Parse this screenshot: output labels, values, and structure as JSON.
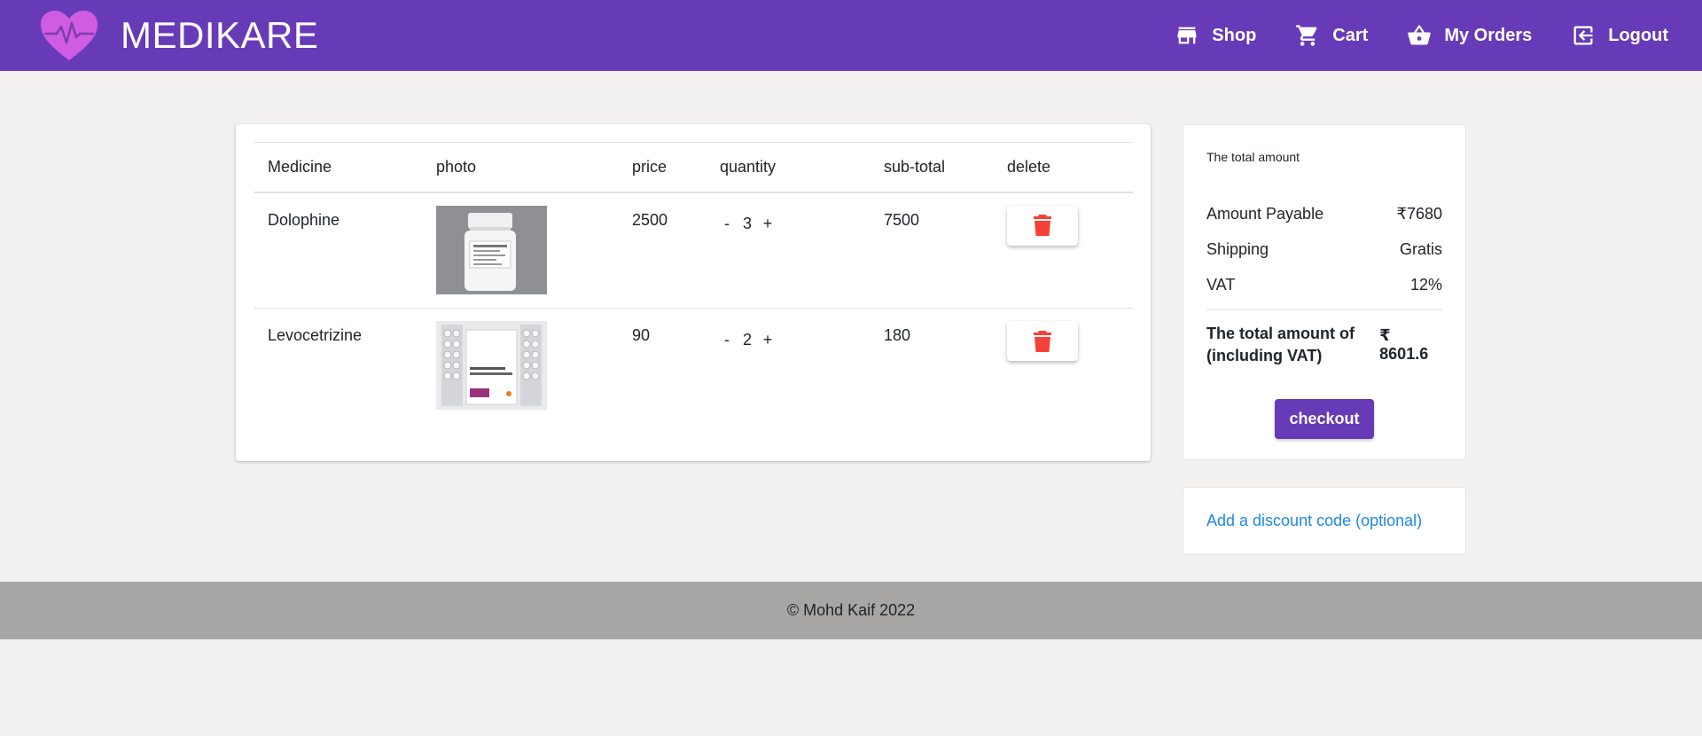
{
  "brand": {
    "name": "MEDIKARE",
    "logo_icon": "heart-pulse-icon",
    "logo_color": "#d05ce3"
  },
  "nav": [
    {
      "key": "shop",
      "label": "Shop",
      "icon": "store-icon"
    },
    {
      "key": "cart",
      "label": "Cart",
      "icon": "cart-icon"
    },
    {
      "key": "orders",
      "label": "My Orders",
      "icon": "basket-icon"
    },
    {
      "key": "logout",
      "label": "Logout",
      "icon": "logout-icon"
    }
  ],
  "cart": {
    "columns": [
      "Medicine",
      "photo",
      "price",
      "quantity",
      "sub-total",
      "delete"
    ],
    "items": [
      {
        "name": "Dolophine",
        "price": "2500",
        "quantity": "3",
        "subtotal": "7500",
        "photo_icon": "pill-bottle-photo"
      },
      {
        "name": "Levocetrizine",
        "price": "90",
        "quantity": "2",
        "subtotal": "180",
        "photo_icon": "tablet-strip-photo"
      }
    ],
    "decrement_label": "-",
    "increment_label": "+"
  },
  "summary": {
    "heading": "The total amount",
    "rows": [
      {
        "label": "Amount Payable",
        "value": "₹7680"
      },
      {
        "label": "Shipping",
        "value": "Gratis"
      },
      {
        "label": "VAT",
        "value": "12%"
      }
    ],
    "total_label": "The total amount of (including VAT)",
    "total_value": "₹ 8601.6",
    "checkout_label": "checkout"
  },
  "discount": {
    "label": "Add a discount code (optional)"
  },
  "footer": {
    "text": "© Mohd Kaif 2022"
  },
  "colors": {
    "primary": "#673ab7",
    "delete": "#f44336",
    "link": "#1e88e5",
    "footer_bg": "#a8a6a5",
    "page_bg": "#f2f1ef"
  }
}
